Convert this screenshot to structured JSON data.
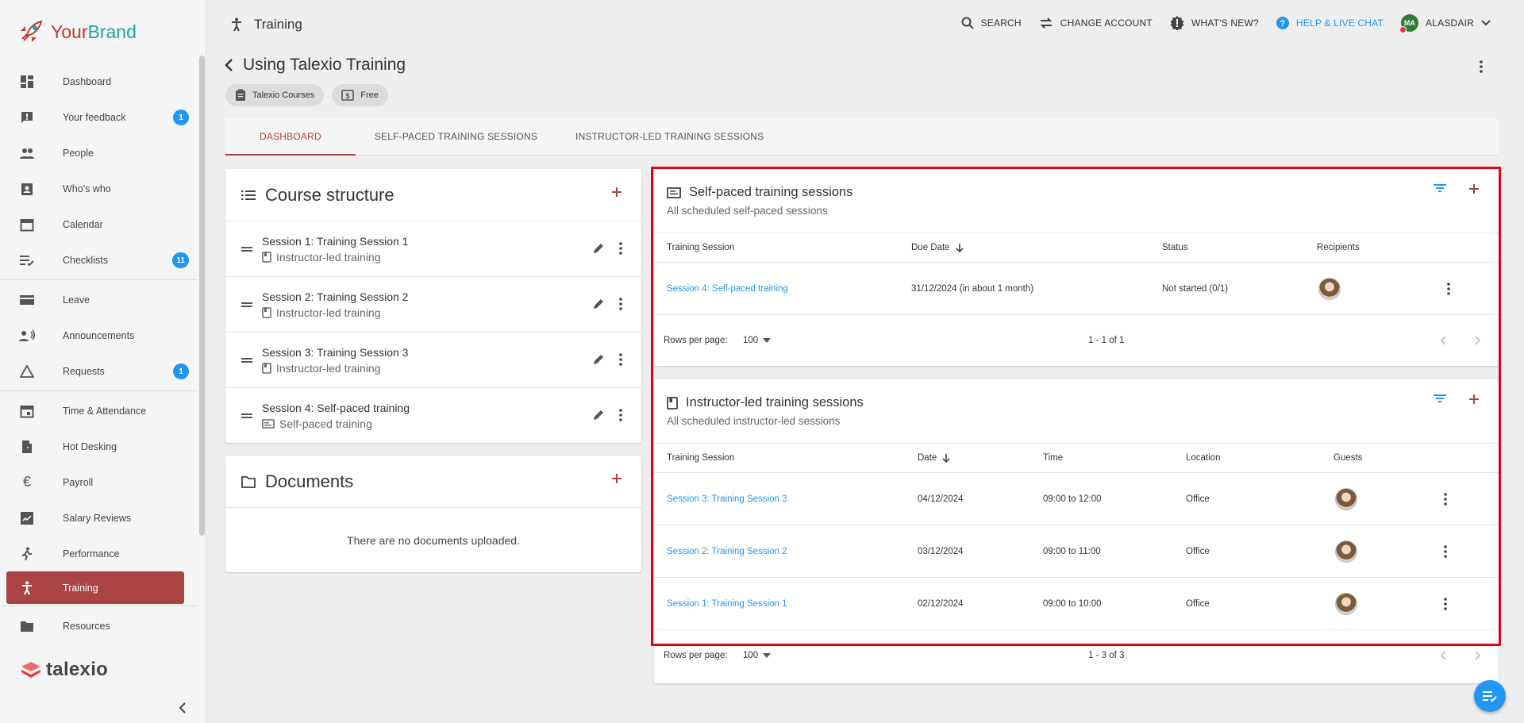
{
  "brand": {
    "part1": "Your",
    "part2": "Brand"
  },
  "sidebar": {
    "items": [
      {
        "label": "Dashboard",
        "icon": "dashboard-icon"
      },
      {
        "label": "Your feedback",
        "icon": "feedback-icon",
        "badge": "1"
      },
      {
        "label": "People",
        "icon": "people-icon"
      },
      {
        "label": "Who's who",
        "icon": "contact-badge-icon"
      },
      {
        "label": "Calendar",
        "icon": "calendar-icon"
      },
      {
        "label": "Checklists",
        "icon": "checklist-icon",
        "badge": "11"
      },
      {
        "label": "Leave",
        "icon": "leave-icon"
      },
      {
        "label": "Announcements",
        "icon": "announcement-icon"
      },
      {
        "label": "Requests",
        "icon": "requests-icon",
        "badge": "1"
      },
      {
        "label": "Time & Attendance",
        "icon": "time-attendance-icon"
      },
      {
        "label": "Hot Desking",
        "icon": "hot-desking-icon"
      },
      {
        "label": "Payroll",
        "icon": "euro-icon"
      },
      {
        "label": "Salary Reviews",
        "icon": "salary-review-icon"
      },
      {
        "label": "Performance",
        "icon": "performance-icon"
      },
      {
        "label": "Training",
        "icon": "training-icon",
        "active": true
      },
      {
        "label": "Resources",
        "icon": "folder-icon"
      }
    ],
    "footer_logo": "talexio"
  },
  "topbar": {
    "section": "Training",
    "search": "SEARCH",
    "change_account": "CHANGE ACCOUNT",
    "whats_new": "WHAT'S NEW?",
    "help": "HELP & LIVE CHAT",
    "user_initials": "MA",
    "user_name": "ALASDAIR"
  },
  "page": {
    "title": "Using Talexio Training",
    "chips": [
      "Talexio Courses",
      "Free"
    ]
  },
  "tabs": [
    "DASHBOARD",
    "SELF-PACED TRAINING SESSIONS",
    "INSTRUCTOR-LED TRAINING SESSIONS"
  ],
  "course_structure": {
    "title": "Course structure",
    "sessions": [
      {
        "name": "Session 1: Training Session 1",
        "type": "Instructor-led training"
      },
      {
        "name": "Session 2: Training Session 2",
        "type": "Instructor-led training"
      },
      {
        "name": "Session 3: Training Session 3",
        "type": "Instructor-led training"
      },
      {
        "name": "Session 4: Self-paced training",
        "type": "Self-paced training"
      }
    ]
  },
  "documents": {
    "title": "Documents",
    "empty": "There are no documents uploaded."
  },
  "self_paced": {
    "title": "Self-paced training sessions",
    "subtitle": "All scheduled self-paced sessions",
    "columns": [
      "Training Session",
      "Due Date",
      "Status",
      "Recipients"
    ],
    "rows": [
      {
        "session": "Session 4: Self-paced training",
        "due": "31/12/2024 (in about 1 month)",
        "status": "Not started (0/1)"
      }
    ],
    "rows_per_page_label": "Rows per page:",
    "rows_per_page": "100",
    "range": "1 - 1 of 1"
  },
  "instructor_led": {
    "title": "Instructor-led training sessions",
    "subtitle": "All scheduled instructor-led sessions",
    "columns": [
      "Training Session",
      "Date",
      "Time",
      "Location",
      "Guests"
    ],
    "rows": [
      {
        "session": "Session 3: Training Session 3",
        "date": "04/12/2024",
        "time": "09:00 to 12:00",
        "location": "Office"
      },
      {
        "session": "Session 2: Training Session 2",
        "date": "03/12/2024",
        "time": "09:00 to 11:00",
        "location": "Office"
      },
      {
        "session": "Session 1: Training Session 1",
        "date": "02/12/2024",
        "time": "09:00 to 10:00",
        "location": "Office"
      }
    ],
    "rows_per_page_label": "Rows per page:",
    "rows_per_page": "100",
    "range": "1 - 3 of 3"
  },
  "colors": {
    "accent": "#a94442",
    "link": "#2196f3",
    "badge": "#2196f3",
    "highlight": "#e3000f"
  }
}
